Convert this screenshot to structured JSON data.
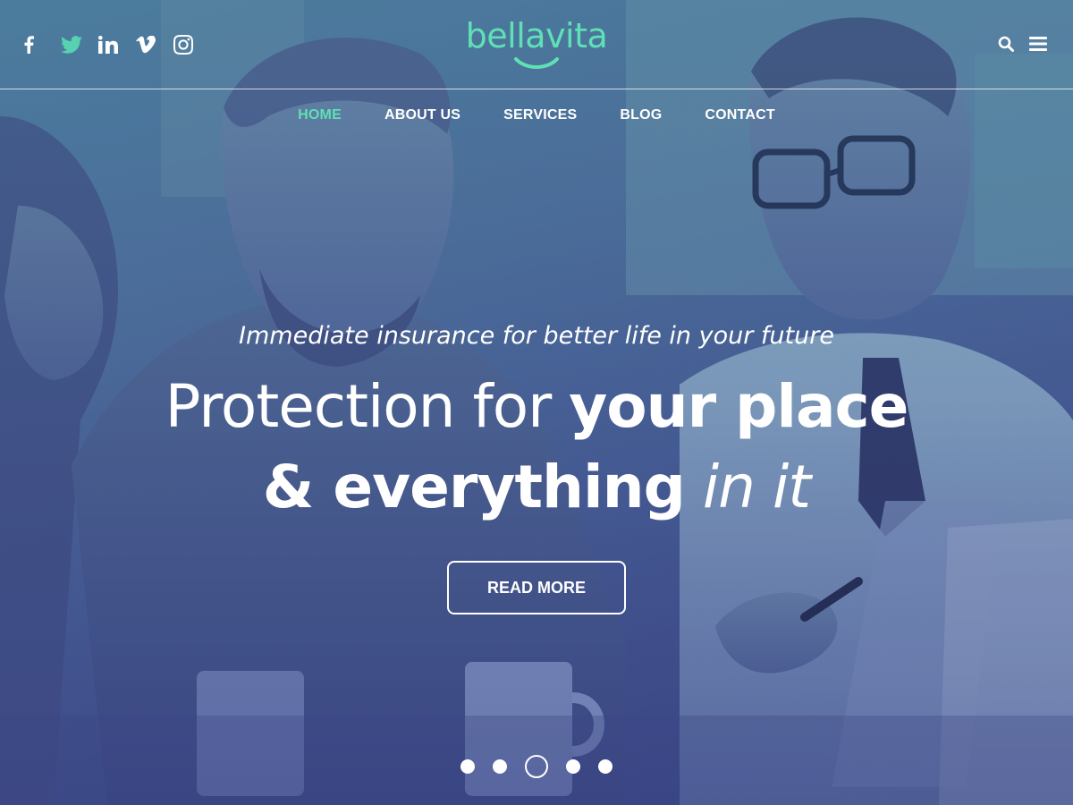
{
  "brand": {
    "logo_text": "bellavita",
    "accent_color": "#5fe0b5"
  },
  "social": [
    {
      "name": "facebook-icon"
    },
    {
      "name": "twitter-icon"
    },
    {
      "name": "linkedin-icon"
    },
    {
      "name": "vimeo-icon"
    },
    {
      "name": "instagram-icon"
    }
  ],
  "header_actions": [
    {
      "name": "search-icon"
    },
    {
      "name": "hamburger-menu-icon"
    }
  ],
  "nav": {
    "items": [
      {
        "label": "HOME",
        "active": true
      },
      {
        "label": "ABOUT US",
        "active": false
      },
      {
        "label": "SERVICES",
        "active": false
      },
      {
        "label": "BLOG",
        "active": false
      },
      {
        "label": "CONTACT",
        "active": false
      }
    ]
  },
  "hero": {
    "tagline": "Immediate insurance for better life in your future",
    "headline": {
      "line1_thin": "Protection for ",
      "line1_bold": "your place",
      "line2_bold": "& everything",
      "line2_italic": " in it"
    },
    "button_label": "READ MORE"
  },
  "slider": {
    "total": 5,
    "active_index": 2
  }
}
